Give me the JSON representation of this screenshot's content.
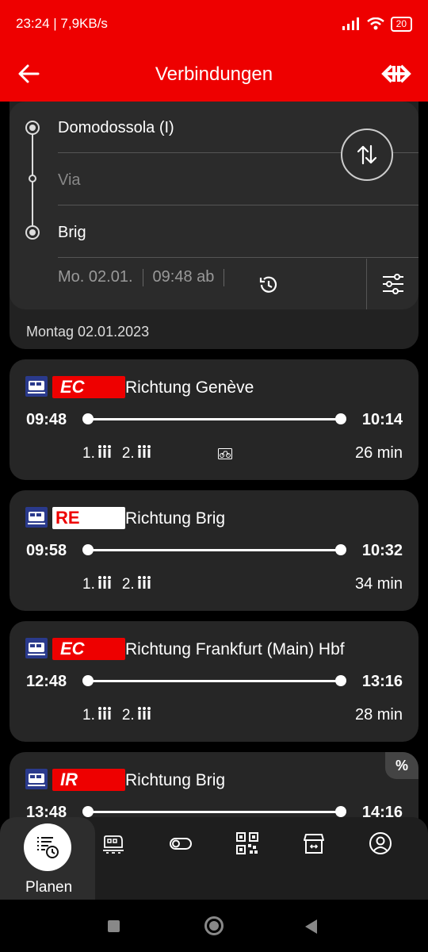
{
  "status": {
    "time_info": "23:24 | 7,9KB/s",
    "battery": "20"
  },
  "header": {
    "title": "Verbindungen"
  },
  "search": {
    "from": "Domodossola (I)",
    "via_placeholder": "Via",
    "to": "Brig",
    "date": "Mo. 02.01.",
    "time": "09:48 ab"
  },
  "results": {
    "date_label": "Montag 02.01.2023",
    "connections": [
      {
        "badge": "EC",
        "badge_style": "red",
        "direction": "Richtung Genève",
        "dep": "09:48",
        "arr": "10:14",
        "class1": "1.",
        "class2": "2.",
        "bike": true,
        "duration": "26 min",
        "discount": ""
      },
      {
        "badge": "RE",
        "badge_style": "white",
        "direction": "Richtung Brig",
        "dep": "09:58",
        "arr": "10:32",
        "class1": "1.",
        "class2": "2.",
        "bike": false,
        "duration": "34 min",
        "discount": ""
      },
      {
        "badge": "EC",
        "badge_style": "red",
        "direction": "Richtung Frankfurt (Main) Hbf",
        "dep": "12:48",
        "arr": "13:16",
        "class1": "1.",
        "class2": "2.",
        "bike": false,
        "duration": "28 min",
        "discount": ""
      },
      {
        "badge": "IR",
        "badge_style": "red",
        "direction": "Richtung Brig",
        "dep": "13:48",
        "arr": "14:16",
        "class1": "",
        "class2": "",
        "bike": false,
        "duration": "",
        "discount": "%"
      }
    ]
  },
  "nav": {
    "active_label": "Planen",
    "items": [
      "plan-icon",
      "train-icon",
      "ticket-toggle-icon",
      "qr-code-icon",
      "shop-icon",
      "profile-icon"
    ]
  },
  "colors": {
    "brand": "#EE0000",
    "card": "#262626",
    "background": "#000000"
  }
}
